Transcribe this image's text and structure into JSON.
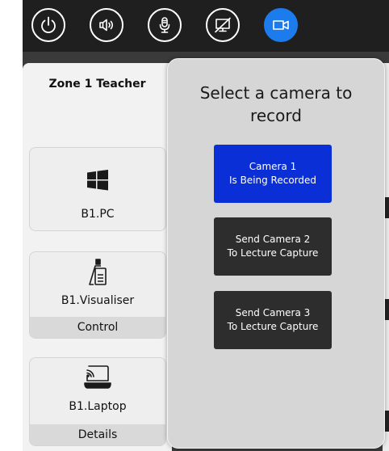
{
  "toolbar": {
    "buttons": [
      {
        "icon": "power-icon"
      },
      {
        "icon": "speaker-volume-icon"
      },
      {
        "icon": "microphone-icon"
      },
      {
        "icon": "display-off-icon"
      },
      {
        "icon": "video-camera-icon",
        "active": true
      }
    ],
    "active_color": "#1c7ced"
  },
  "zone": {
    "title": "Zone 1 Teacher"
  },
  "sources": [
    {
      "label": "B1.PC",
      "icon": "windows-logo-icon"
    },
    {
      "label": "B1.Visualiser",
      "icon": "document-camera-icon",
      "action": "Control"
    },
    {
      "label": "B1.Laptop",
      "icon": "laptop-cast-icon",
      "action": "Details"
    }
  ],
  "camera_modal": {
    "title": "Select a camera to\nrecord",
    "cameras": [
      {
        "label": "Camera 1\nIs Being Recorded",
        "active": true,
        "color": "#0a2fd6"
      },
      {
        "label": "Send Camera 2\nTo Lecture Capture",
        "active": false,
        "color": "#2d2d2d"
      },
      {
        "label": "Send Camera 3\nTo Lecture Capture",
        "active": false,
        "color": "#2d2d2d"
      }
    ]
  }
}
